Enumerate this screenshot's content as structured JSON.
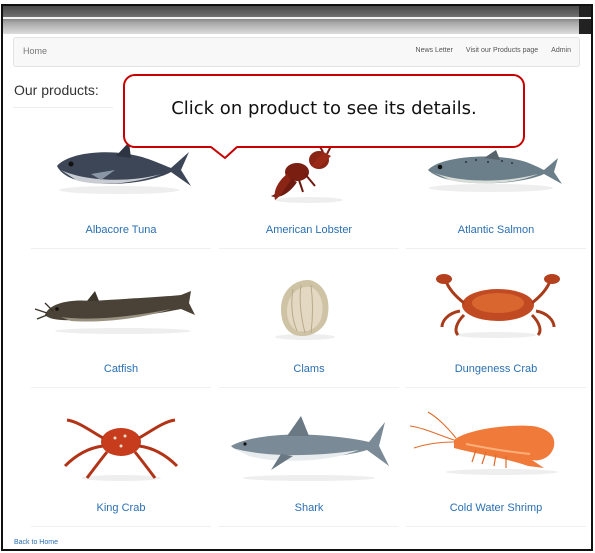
{
  "navbar": {
    "home": "Home",
    "links": [
      "News Letter",
      "Visit our Products page",
      "Admin"
    ]
  },
  "page": {
    "title": "Our products:"
  },
  "callout": {
    "text": "Click on product to see its details."
  },
  "products": [
    {
      "name": "Albacore Tuna",
      "icon": "tuna-image"
    },
    {
      "name": "American Lobster",
      "icon": "lobster-image"
    },
    {
      "name": "Atlantic Salmon",
      "icon": "salmon-image"
    },
    {
      "name": "Catfish",
      "icon": "catfish-image"
    },
    {
      "name": "Clams",
      "icon": "clam-image"
    },
    {
      "name": "Dungeness Crab",
      "icon": "dungeness-crab-image"
    },
    {
      "name": "King Crab",
      "icon": "king-crab-image"
    },
    {
      "name": "Shark",
      "icon": "shark-image"
    },
    {
      "name": "Cold Water Shrimp",
      "icon": "shrimp-image"
    }
  ],
  "footer": {
    "back_link": "Back to Home"
  },
  "colors": {
    "link": "#2a6fb3",
    "callout_border": "#c80000",
    "navbar_bg": "#f8f8f8"
  }
}
